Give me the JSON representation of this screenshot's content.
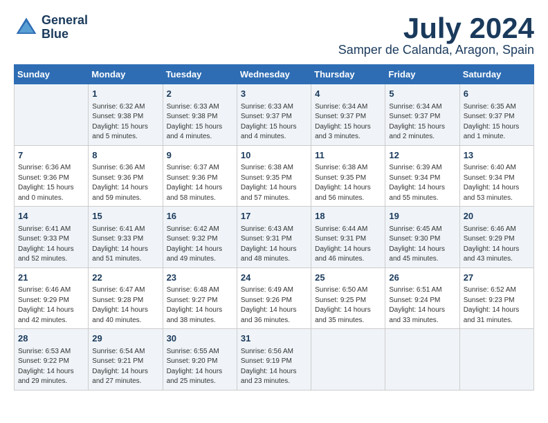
{
  "logo": {
    "line1": "General",
    "line2": "Blue"
  },
  "title": "July 2024",
  "location": "Samper de Calanda, Aragon, Spain",
  "days_of_week": [
    "Sunday",
    "Monday",
    "Tuesday",
    "Wednesday",
    "Thursday",
    "Friday",
    "Saturday"
  ],
  "weeks": [
    [
      {
        "day": "",
        "content": ""
      },
      {
        "day": "1",
        "content": "Sunrise: 6:32 AM\nSunset: 9:38 PM\nDaylight: 15 hours\nand 5 minutes."
      },
      {
        "day": "2",
        "content": "Sunrise: 6:33 AM\nSunset: 9:38 PM\nDaylight: 15 hours\nand 4 minutes."
      },
      {
        "day": "3",
        "content": "Sunrise: 6:33 AM\nSunset: 9:37 PM\nDaylight: 15 hours\nand 4 minutes."
      },
      {
        "day": "4",
        "content": "Sunrise: 6:34 AM\nSunset: 9:37 PM\nDaylight: 15 hours\nand 3 minutes."
      },
      {
        "day": "5",
        "content": "Sunrise: 6:34 AM\nSunset: 9:37 PM\nDaylight: 15 hours\nand 2 minutes."
      },
      {
        "day": "6",
        "content": "Sunrise: 6:35 AM\nSunset: 9:37 PM\nDaylight: 15 hours\nand 1 minute."
      }
    ],
    [
      {
        "day": "7",
        "content": "Sunrise: 6:36 AM\nSunset: 9:36 PM\nDaylight: 15 hours\nand 0 minutes."
      },
      {
        "day": "8",
        "content": "Sunrise: 6:36 AM\nSunset: 9:36 PM\nDaylight: 14 hours\nand 59 minutes."
      },
      {
        "day": "9",
        "content": "Sunrise: 6:37 AM\nSunset: 9:36 PM\nDaylight: 14 hours\nand 58 minutes."
      },
      {
        "day": "10",
        "content": "Sunrise: 6:38 AM\nSunset: 9:35 PM\nDaylight: 14 hours\nand 57 minutes."
      },
      {
        "day": "11",
        "content": "Sunrise: 6:38 AM\nSunset: 9:35 PM\nDaylight: 14 hours\nand 56 minutes."
      },
      {
        "day": "12",
        "content": "Sunrise: 6:39 AM\nSunset: 9:34 PM\nDaylight: 14 hours\nand 55 minutes."
      },
      {
        "day": "13",
        "content": "Sunrise: 6:40 AM\nSunset: 9:34 PM\nDaylight: 14 hours\nand 53 minutes."
      }
    ],
    [
      {
        "day": "14",
        "content": "Sunrise: 6:41 AM\nSunset: 9:33 PM\nDaylight: 14 hours\nand 52 minutes."
      },
      {
        "day": "15",
        "content": "Sunrise: 6:41 AM\nSunset: 9:33 PM\nDaylight: 14 hours\nand 51 minutes."
      },
      {
        "day": "16",
        "content": "Sunrise: 6:42 AM\nSunset: 9:32 PM\nDaylight: 14 hours\nand 49 minutes."
      },
      {
        "day": "17",
        "content": "Sunrise: 6:43 AM\nSunset: 9:31 PM\nDaylight: 14 hours\nand 48 minutes."
      },
      {
        "day": "18",
        "content": "Sunrise: 6:44 AM\nSunset: 9:31 PM\nDaylight: 14 hours\nand 46 minutes."
      },
      {
        "day": "19",
        "content": "Sunrise: 6:45 AM\nSunset: 9:30 PM\nDaylight: 14 hours\nand 45 minutes."
      },
      {
        "day": "20",
        "content": "Sunrise: 6:46 AM\nSunset: 9:29 PM\nDaylight: 14 hours\nand 43 minutes."
      }
    ],
    [
      {
        "day": "21",
        "content": "Sunrise: 6:46 AM\nSunset: 9:29 PM\nDaylight: 14 hours\nand 42 minutes."
      },
      {
        "day": "22",
        "content": "Sunrise: 6:47 AM\nSunset: 9:28 PM\nDaylight: 14 hours\nand 40 minutes."
      },
      {
        "day": "23",
        "content": "Sunrise: 6:48 AM\nSunset: 9:27 PM\nDaylight: 14 hours\nand 38 minutes."
      },
      {
        "day": "24",
        "content": "Sunrise: 6:49 AM\nSunset: 9:26 PM\nDaylight: 14 hours\nand 36 minutes."
      },
      {
        "day": "25",
        "content": "Sunrise: 6:50 AM\nSunset: 9:25 PM\nDaylight: 14 hours\nand 35 minutes."
      },
      {
        "day": "26",
        "content": "Sunrise: 6:51 AM\nSunset: 9:24 PM\nDaylight: 14 hours\nand 33 minutes."
      },
      {
        "day": "27",
        "content": "Sunrise: 6:52 AM\nSunset: 9:23 PM\nDaylight: 14 hours\nand 31 minutes."
      }
    ],
    [
      {
        "day": "28",
        "content": "Sunrise: 6:53 AM\nSunset: 9:22 PM\nDaylight: 14 hours\nand 29 minutes."
      },
      {
        "day": "29",
        "content": "Sunrise: 6:54 AM\nSunset: 9:21 PM\nDaylight: 14 hours\nand 27 minutes."
      },
      {
        "day": "30",
        "content": "Sunrise: 6:55 AM\nSunset: 9:20 PM\nDaylight: 14 hours\nand 25 minutes."
      },
      {
        "day": "31",
        "content": "Sunrise: 6:56 AM\nSunset: 9:19 PM\nDaylight: 14 hours\nand 23 minutes."
      },
      {
        "day": "",
        "content": ""
      },
      {
        "day": "",
        "content": ""
      },
      {
        "day": "",
        "content": ""
      }
    ]
  ]
}
